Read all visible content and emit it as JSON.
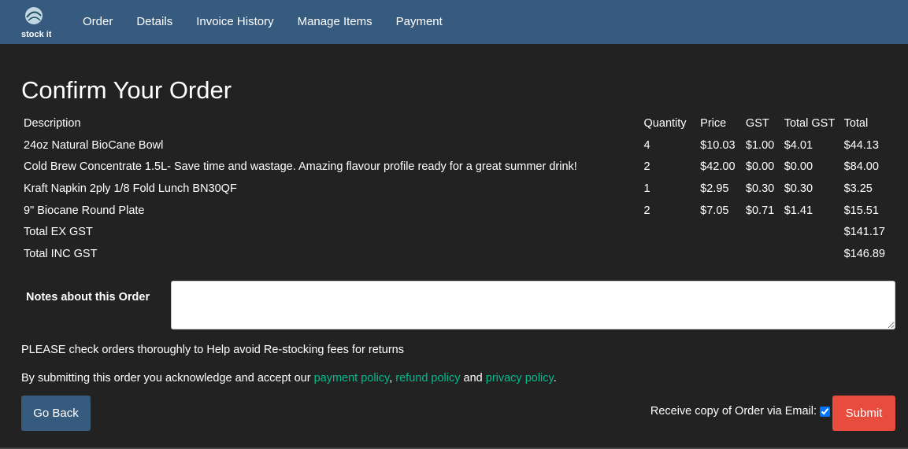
{
  "nav": {
    "logo_text": "stock it",
    "items": [
      "Order",
      "Details",
      "Invoice History",
      "Manage Items",
      "Payment"
    ]
  },
  "page": {
    "title": "Confirm Your Order"
  },
  "table": {
    "headers": {
      "description": "Description",
      "quantity": "Quantity",
      "price": "Price",
      "gst": "GST",
      "total_gst": "Total GST",
      "total": "Total"
    },
    "rows": [
      {
        "description": "24oz Natural BioCane Bowl",
        "quantity": "4",
        "price": "$10.03",
        "gst": "$1.00",
        "total_gst": "$4.01",
        "total": "$44.13"
      },
      {
        "description": "Cold Brew Concentrate 1.5L- Save time and wastage. Amazing flavour profile ready for a great summer drink!",
        "quantity": "2",
        "price": "$42.00",
        "gst": "$0.00",
        "total_gst": "$0.00",
        "total": "$84.00"
      },
      {
        "description": "Kraft Napkin 2ply 1/8 Fold Lunch BN30QF",
        "quantity": "1",
        "price": "$2.95",
        "gst": "$0.30",
        "total_gst": "$0.30",
        "total": "$3.25"
      },
      {
        "description": "9\" Biocane Round Plate",
        "quantity": "2",
        "price": "$7.05",
        "gst": "$0.71",
        "total_gst": "$1.41",
        "total": "$15.51"
      }
    ],
    "totals": {
      "ex_gst_label": "Total EX GST",
      "ex_gst_value": "$141.17",
      "inc_gst_label": "Total INC GST",
      "inc_gst_value": "$146.89"
    }
  },
  "notes": {
    "label": "Notes about this Order",
    "value": ""
  },
  "warning": "PLEASE check orders thoroughly to Help avoid Re-stocking fees for returns",
  "ack": {
    "prefix": "By submitting this order you acknowledge and accept our ",
    "payment_policy": "payment policy",
    "sep1": ",",
    "refund_policy": "refund policy",
    "and": " and ",
    "privacy_policy": "privacy policy",
    "suffix": "."
  },
  "buttons": {
    "back": "Go Back",
    "submit": "Submit"
  },
  "email_option": {
    "label": "Receive copy of Order via Email:",
    "checked": true
  },
  "colors": {
    "navbar": "#375a7f",
    "background": "#222222",
    "link": "#00bc8c",
    "submit": "#e74c3c"
  }
}
